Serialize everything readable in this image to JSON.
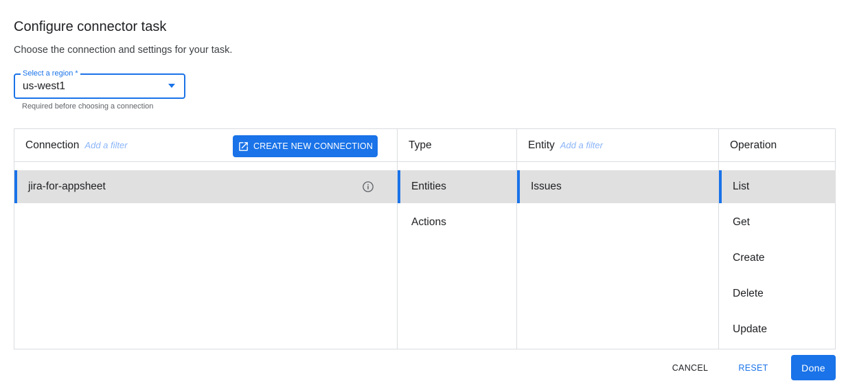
{
  "dialog": {
    "title": "Configure connector task",
    "subtitle": "Choose the connection and settings for your task."
  },
  "region": {
    "label": "Select a region *",
    "value": "us-west1",
    "hint": "Required before choosing a connection"
  },
  "columns": {
    "connection": {
      "title": "Connection",
      "filter": "Add a filter",
      "create_label": "CREATE NEW CONNECTION",
      "create_icon": "open-in-new-icon",
      "items": [
        {
          "label": "jira-for-appsheet",
          "selected": true,
          "icon": "info-icon"
        }
      ]
    },
    "type": {
      "title": "Type",
      "items": [
        {
          "label": "Entities",
          "selected": true
        },
        {
          "label": "Actions",
          "selected": false
        }
      ]
    },
    "entity": {
      "title": "Entity",
      "filter": "Add a filter",
      "items": [
        {
          "label": "Issues",
          "selected": true
        }
      ]
    },
    "operation": {
      "title": "Operation",
      "items": [
        {
          "label": "List",
          "selected": true
        },
        {
          "label": "Get",
          "selected": false
        },
        {
          "label": "Create",
          "selected": false
        },
        {
          "label": "Delete",
          "selected": false
        },
        {
          "label": "Update",
          "selected": false
        }
      ]
    }
  },
  "footer": {
    "cancel_label": "CANCEL",
    "reset_label": "RESET",
    "done_label": "Done"
  },
  "colors": {
    "accent": "#1a73e8",
    "selected_row": "#e0e0e0",
    "filter_text": "#8ab4f8"
  }
}
